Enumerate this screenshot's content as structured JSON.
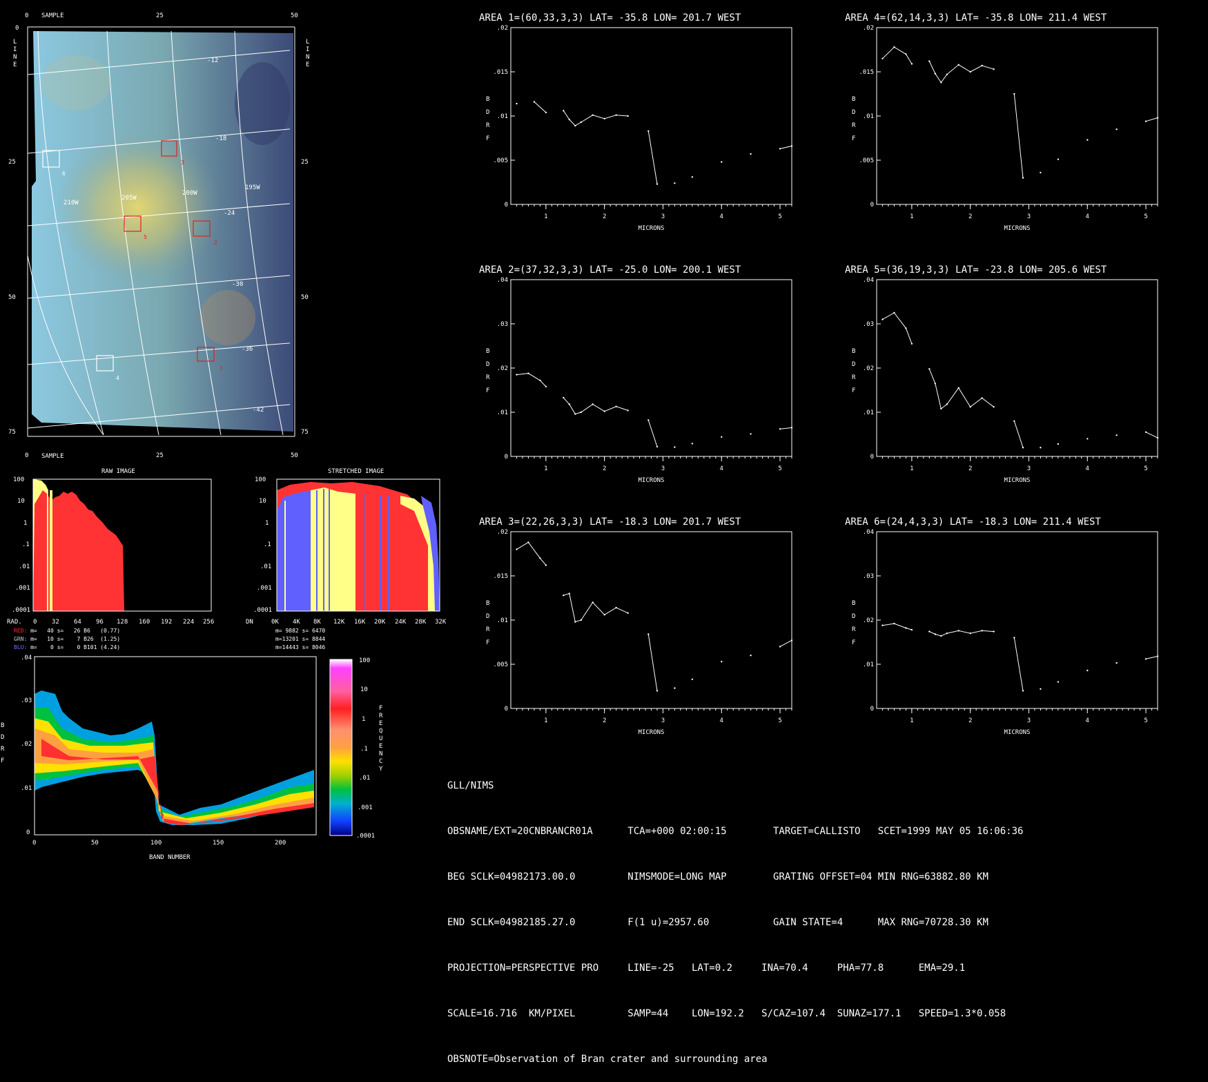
{
  "image_panel": {
    "top_label": "SAMPLE",
    "bottom_label": "SAMPLE",
    "side_label": "LINE",
    "x_ticks": [
      "0",
      "25",
      "50"
    ],
    "y_ticks": [
      "0",
      "25",
      "50",
      "75"
    ],
    "lat_labels": [
      "-12",
      "-18",
      "-24",
      "-30",
      "-36",
      "-42"
    ],
    "lon_labels": [
      "210W",
      "205W",
      "200W",
      "195W"
    ],
    "area_boxes": [
      {
        "id": "1",
        "color": "#e02020"
      },
      {
        "id": "2",
        "color": "#e02020"
      },
      {
        "id": "3",
        "color": "#e02020"
      },
      {
        "id": "4",
        "color": "#ffffff"
      },
      {
        "id": "5",
        "color": "#e02020"
      },
      {
        "id": "6",
        "color": "#ffffff"
      }
    ]
  },
  "raw_hist": {
    "title": "RAW IMAGE",
    "x_prefix": "RAD.",
    "x_ticks": [
      "0",
      "32",
      "64",
      "96",
      "128",
      "160",
      "192",
      "224",
      "256"
    ],
    "y_ticks": [
      "100",
      "10",
      "1",
      ".1",
      ".01",
      ".001",
      ".0001"
    ],
    "stats": [
      {
        "label": "RED:",
        "color": "#ff3030",
        "text": " m=   40 s=   26 B6   (0.77)"
      },
      {
        "label": "GRN:",
        "color": "#c8c8c8",
        "text": " m=   10 s=    7 B26  (1.25)"
      },
      {
        "label": "BLU:",
        "color": "#7070ff",
        "text": " m=    0 s=    0 B101 (4.24)"
      }
    ]
  },
  "stretched_hist": {
    "title": "STRETCHED IMAGE",
    "x_prefix": "DN",
    "x_ticks": [
      "0K",
      "4K",
      "8K",
      "12K",
      "16K",
      "20K",
      "24K",
      "28K",
      "32K"
    ],
    "y_ticks": [
      "100",
      "10",
      "1",
      ".1",
      ".01",
      ".001",
      ".0001"
    ],
    "stats": [
      "m= 9882 s= 6470",
      "m=13201 s= 8844",
      "m=14443 s= 8046"
    ]
  },
  "density_plot": {
    "ylabel": "BDRF",
    "xlabel": "BAND NUMBER",
    "x_ticks": [
      "0",
      "50",
      "100",
      "150",
      "200"
    ],
    "y_ticks": [
      ".04",
      ".03",
      ".02",
      ".01",
      "0"
    ],
    "colorbar_label": "FREQUENCY",
    "colorbar_ticks": [
      "100",
      "10",
      "1",
      ".1",
      ".01",
      ".001",
      ".0001"
    ]
  },
  "chart_data": [
    {
      "type": "line",
      "title": "AREA 1=(60,33,3,3) LAT= -35.8 LON= 201.7 WEST",
      "xlabel": "MICRONS",
      "ylabel": "BDRF",
      "xlim": [
        0.4,
        5.2
      ],
      "ylim": [
        0,
        0.02
      ],
      "y_ticks": [
        ".02",
        ".015",
        ".01",
        ".005",
        "0"
      ],
      "x_ticks": [
        "1",
        "2",
        "3",
        "4",
        "5"
      ],
      "x": [
        0.5,
        0.8,
        1.0,
        1.3,
        1.4,
        1.5,
        1.6,
        1.8,
        2.0,
        2.2,
        2.4,
        2.75,
        2.9,
        3.2,
        3.5,
        4.0,
        4.5,
        5.0,
        5.2
      ],
      "y": [
        0.0114,
        0.0116,
        0.0104,
        0.0106,
        0.0096,
        0.0089,
        0.0093,
        0.0101,
        0.0097,
        0.0101,
        0.01,
        0.0083,
        0.0023,
        0.0024,
        0.0031,
        0.0048,
        0.0057,
        0.0063,
        0.0066
      ]
    },
    {
      "type": "line",
      "title": "AREA 4=(62,14,3,3) LAT= -35.8 LON= 211.4 WEST",
      "xlabel": "MICRONS",
      "ylabel": "BDRF",
      "xlim": [
        0.4,
        5.2
      ],
      "ylim": [
        0,
        0.02
      ],
      "y_ticks": [
        ".02",
        ".015",
        ".01",
        ".005",
        "0"
      ],
      "x_ticks": [
        "1",
        "2",
        "3",
        "4",
        "5"
      ],
      "x": [
        0.5,
        0.7,
        0.9,
        1.0,
        1.3,
        1.4,
        1.5,
        1.6,
        1.8,
        2.0,
        2.2,
        2.4,
        2.75,
        2.9,
        3.2,
        3.5,
        4.0,
        4.5,
        5.0,
        5.2
      ],
      "y": [
        0.0165,
        0.0178,
        0.017,
        0.0159,
        0.0162,
        0.0148,
        0.0138,
        0.0147,
        0.0158,
        0.015,
        0.0157,
        0.0153,
        0.0125,
        0.003,
        0.0036,
        0.0051,
        0.0073,
        0.0085,
        0.0094,
        0.0098
      ]
    },
    {
      "type": "line",
      "title": "AREA 2=(37,32,3,3) LAT= -25.0 LON= 200.1 WEST",
      "xlabel": "MICRONS",
      "ylabel": "BDRF",
      "xlim": [
        0.4,
        5.2
      ],
      "ylim": [
        0,
        0.04
      ],
      "y_ticks": [
        ".04",
        ".03",
        ".02",
        ".01",
        "0"
      ],
      "x_ticks": [
        "1",
        "2",
        "3",
        "4",
        "5"
      ],
      "x": [
        0.5,
        0.7,
        0.9,
        1.0,
        1.3,
        1.4,
        1.5,
        1.6,
        1.8,
        2.0,
        2.2,
        2.4,
        2.75,
        2.9,
        3.2,
        3.5,
        4.0,
        4.5,
        5.0,
        5.2
      ],
      "y": [
        0.0185,
        0.0188,
        0.0172,
        0.0158,
        0.0133,
        0.0118,
        0.0096,
        0.01,
        0.0118,
        0.0102,
        0.0113,
        0.0104,
        0.0082,
        0.0022,
        0.0021,
        0.0029,
        0.0044,
        0.0051,
        0.0062,
        0.0065
      ]
    },
    {
      "type": "line",
      "title": "AREA 5=(36,19,3,3) LAT= -23.8 LON= 205.6 WEST",
      "xlabel": "MICRONS",
      "ylabel": "BDRF",
      "xlim": [
        0.4,
        5.2
      ],
      "ylim": [
        0,
        0.04
      ],
      "y_ticks": [
        ".04",
        ".03",
        ".02",
        ".01",
        "0"
      ],
      "x_ticks": [
        "1",
        "2",
        "3",
        "4",
        "5"
      ],
      "x": [
        0.5,
        0.7,
        0.9,
        1.0,
        1.3,
        1.4,
        1.5,
        1.6,
        1.8,
        2.0,
        2.2,
        2.4,
        2.75,
        2.9,
        3.2,
        3.5,
        4.0,
        4.5,
        5.0,
        5.2
      ],
      "y": [
        0.031,
        0.0325,
        0.029,
        0.0255,
        0.0198,
        0.0165,
        0.0108,
        0.0118,
        0.0155,
        0.0112,
        0.0132,
        0.0112,
        0.008,
        0.002,
        0.002,
        0.0028,
        0.004,
        0.0048,
        0.0055,
        0.0042
      ]
    },
    {
      "type": "line",
      "title": "AREA 3=(22,26,3,3) LAT= -18.3 LON= 201.7 WEST",
      "xlabel": "MICRONS",
      "ylabel": "BDRF",
      "xlim": [
        0.4,
        5.2
      ],
      "ylim": [
        0,
        0.02
      ],
      "y_ticks": [
        ".02",
        ".015",
        ".01",
        ".005",
        "0"
      ],
      "x_ticks": [
        "1",
        "2",
        "3",
        "4",
        "5"
      ],
      "x": [
        0.5,
        0.7,
        0.9,
        1.0,
        1.3,
        1.4,
        1.5,
        1.6,
        1.8,
        2.0,
        2.2,
        2.4,
        2.75,
        2.9,
        3.2,
        3.5,
        4.0,
        4.5,
        5.0,
        5.2
      ],
      "y": [
        0.018,
        0.0188,
        0.017,
        0.0162,
        0.0128,
        0.013,
        0.0098,
        0.01,
        0.012,
        0.0106,
        0.0114,
        0.0108,
        0.0084,
        0.002,
        0.0023,
        0.0033,
        0.0053,
        0.006,
        0.007,
        0.0077
      ]
    },
    {
      "type": "line",
      "title": "AREA 6=(24,4,3,3) LAT= -18.3 LON= 211.4 WEST",
      "xlabel": "MICRONS",
      "ylabel": "BDRF",
      "xlim": [
        0.4,
        5.2
      ],
      "ylim": [
        0,
        0.04
      ],
      "y_ticks": [
        ".04",
        ".03",
        ".02",
        ".01",
        "0"
      ],
      "x_ticks": [
        "1",
        "2",
        "3",
        "4",
        "5"
      ],
      "x": [
        0.5,
        0.7,
        0.9,
        1.0,
        1.3,
        1.4,
        1.5,
        1.6,
        1.8,
        2.0,
        2.2,
        2.4,
        2.75,
        2.9,
        3.2,
        3.5,
        4.0,
        4.5,
        5.0,
        5.2
      ],
      "y": [
        0.0188,
        0.0192,
        0.0182,
        0.0178,
        0.0174,
        0.0168,
        0.0164,
        0.017,
        0.0176,
        0.017,
        0.0176,
        0.0174,
        0.016,
        0.004,
        0.0044,
        0.006,
        0.0086,
        0.0103,
        0.0112,
        0.0118
      ]
    }
  ],
  "info": {
    "lines": [
      "GLL/NIMS",
      "OBSNAME/EXT=20CNBRANCR01A      TCA=+000 02:00:15        TARGET=CALLISTO   SCET=1999 MAY 05 16:06:36",
      "BEG SCLK=04982173.00.0         NIMSMODE=LONG MAP        GRATING OFFSET=04 MIN RNG=63882.80 KM",
      "END SCLK=04982185.27.0         F(1 u)=2957.60           GAIN STATE=4      MAX RNG=70728.30 KM",
      "PROJECTION=PERSPECTIVE PRO     LINE=-25   LAT=0.2     INA=70.4     PHA=77.8      EMA=29.1",
      "SCALE=16.716  KM/PIXEL         SAMP=44    LON=192.2   S/CAZ=107.4  SUNAZ=177.1   SPEED=1.3*0.058",
      "OBSNOTE=Observation of Bran crater and surrounding area"
    ]
  }
}
